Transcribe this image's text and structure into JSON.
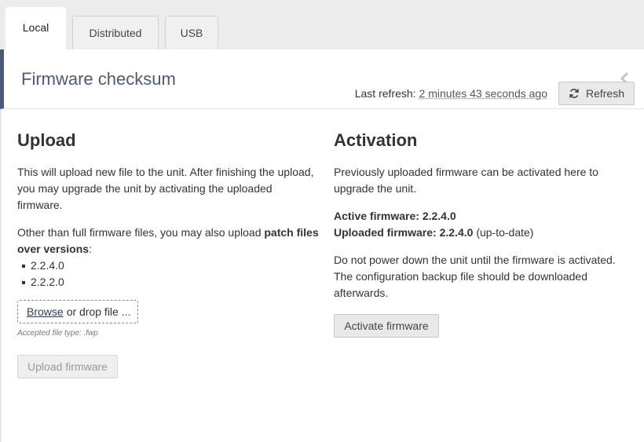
{
  "tabs": [
    {
      "label": "Local"
    },
    {
      "label": "Distributed"
    },
    {
      "label": "USB"
    }
  ],
  "panel": {
    "title": "Firmware checksum"
  },
  "refresh": {
    "label": "Last refresh:",
    "value": "2 minutes 43 seconds ago",
    "button_label": "Refresh"
  },
  "upload": {
    "title": "Upload",
    "description": "This will upload new file to the unit. After finishing the upload, you may upgrade the unit by activating the uploaded firmware.",
    "patch_text_prefix": "Other than full firmware files, you may also upload ",
    "patch_text_bold": "patch files over versions",
    "patch_text_suffix": ":",
    "versions": [
      "2.2.4.0",
      "2.2.2.0"
    ],
    "browse_label": "Browse",
    "drop_label": "or drop file ...",
    "accepted": "Accepted file type: .fwp",
    "button_label": "Upload firmware"
  },
  "activation": {
    "title": "Activation",
    "description": "Previously uploaded firmware can be activated here to upgrade the unit.",
    "active_label": "Active firmware:",
    "active_value": "2.2.4.0",
    "uploaded_label": "Uploaded firmware:",
    "uploaded_value": "2.2.4.0",
    "uploaded_status": "(up-to-date)",
    "warning": "Do not power down the unit until the firmware is activated. The configuration backup file should be downloaded afterwards.",
    "button_label": "Activate firmware"
  },
  "colors": {
    "accent": "#4a5a78",
    "tabbar_bg": "#ececec"
  },
  "icons": {
    "collapse": "chevron-left-icon",
    "refresh": "refresh-icon"
  }
}
